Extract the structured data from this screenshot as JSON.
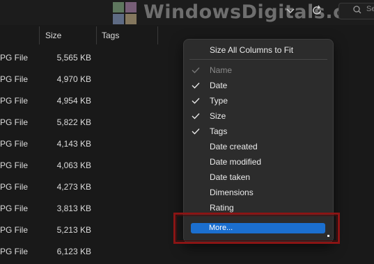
{
  "watermark": {
    "text": "WindowsDigitals.com"
  },
  "toolbar": {
    "search_partial": "Se"
  },
  "columns": {
    "size": "Size",
    "tags": "Tags"
  },
  "rows": [
    {
      "type": "PG File",
      "size": "5,565 KB"
    },
    {
      "type": "PG File",
      "size": "4,970 KB"
    },
    {
      "type": "PG File",
      "size": "4,954 KB"
    },
    {
      "type": "PG File",
      "size": "5,822 KB"
    },
    {
      "type": "PG File",
      "size": "4,143 KB"
    },
    {
      "type": "PG File",
      "size": "4,063 KB"
    },
    {
      "type": "PG File",
      "size": "4,273 KB"
    },
    {
      "type": "PG File",
      "size": "3,813 KB"
    },
    {
      "type": "PG File",
      "size": "5,213 KB"
    },
    {
      "type": "PG File",
      "size": "6,123 KB"
    }
  ],
  "menu": {
    "size_all": "Size All Columns to Fit",
    "items": [
      {
        "label": "Name",
        "checked": true,
        "disabled": true
      },
      {
        "label": "Date",
        "checked": true,
        "disabled": false
      },
      {
        "label": "Type",
        "checked": true,
        "disabled": false
      },
      {
        "label": "Size",
        "checked": true,
        "disabled": false
      },
      {
        "label": "Tags",
        "checked": true,
        "disabled": false
      },
      {
        "label": "Date created",
        "checked": false,
        "disabled": false
      },
      {
        "label": "Date modified",
        "checked": false,
        "disabled": false
      },
      {
        "label": "Date taken",
        "checked": false,
        "disabled": false
      },
      {
        "label": "Dimensions",
        "checked": false,
        "disabled": false
      },
      {
        "label": "Rating",
        "checked": false,
        "disabled": false
      }
    ],
    "more": "More..."
  },
  "colors": {
    "background": "#191919",
    "menu_bg": "#2c2c2c",
    "accent": "#1b6fcf",
    "highlight": "#8b1414"
  }
}
